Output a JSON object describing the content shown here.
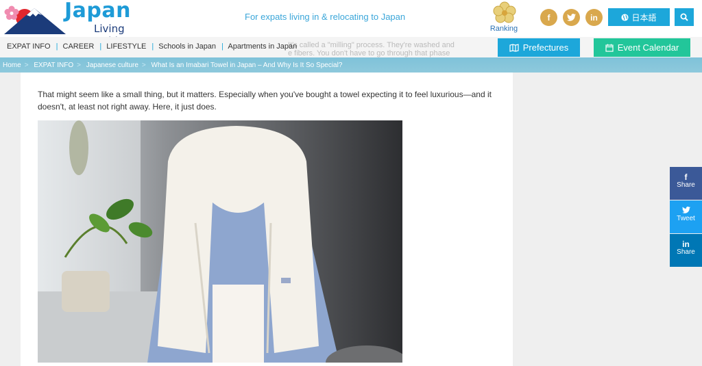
{
  "header": {
    "logo_title": "Japan",
    "logo_subtitle": "Living Guide",
    "tagline": "For expats living in & relocating to Japan",
    "ranking_label": "Ranking",
    "social": [
      {
        "icon": "facebook-icon",
        "glyph": "f"
      },
      {
        "icon": "twitter-icon",
        "glyph": "t"
      },
      {
        "icon": "linkedin-icon",
        "glyph": "in"
      }
    ],
    "language_button": "日本語",
    "search_icon": "search-icon",
    "colors": {
      "brand_blue": "#1da7da",
      "gold": "#d9a84d",
      "green": "#22c69a"
    }
  },
  "nav": {
    "items": [
      "EXPAT INFO",
      "CAREER",
      "LIFESTYLE",
      "Schools in Japan",
      "Apartments in Japan"
    ],
    "ghost_text_line1": "It's called a \"milling\" process. They're washed and",
    "ghost_text_line2": "e fibers. You don't have to go through that phase",
    "prefectures_button": "Prefectures",
    "event_button": "Event Calendar"
  },
  "breadcrumb": [
    "Home",
    "EXPAT INFO",
    "Japanese culture",
    "What Is an Imabari Towel in Japan – And Why Is It So Special?"
  ],
  "article": {
    "paragraph": "That might seem like a small thing, but it matters. Especially when you've bought a towel expecting it to feel luxurious—and it doesn't, at least not right away. Here, it just does."
  },
  "share": [
    {
      "icon": "facebook-icon",
      "glyph": "f",
      "label": "Share",
      "color": "#3b5998"
    },
    {
      "icon": "twitter-icon",
      "glyph": "t",
      "label": "Tweet",
      "color": "#1da1f2"
    },
    {
      "icon": "linkedin-icon",
      "glyph": "in",
      "label": "Share",
      "color": "#0077b5"
    }
  ]
}
